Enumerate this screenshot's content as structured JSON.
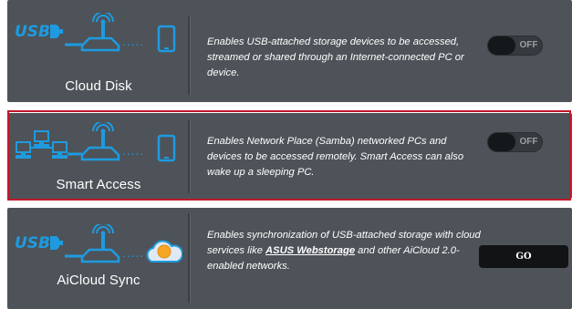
{
  "features": [
    {
      "name": "Cloud Disk",
      "description": "Enables USB-attached storage devices to be accessed, streamed or shared through an Internet-connected PC or device.",
      "toggle": "OFF"
    },
    {
      "name": "Smart Access",
      "description": "Enables Network Place (Samba) networked PCs and devices to be accessed remotely. Smart Access can also wake up a sleeping PC.",
      "toggle": "OFF"
    },
    {
      "name": "AiCloud Sync",
      "description_parts": {
        "before": "Enables synchronization of USB-attached storage with cloud services like ",
        "link": "ASUS Webstorage",
        "after": " and other AiCloud 2.0-enabled networks."
      },
      "button": "GO"
    }
  ],
  "icons": {
    "usb_logo_text": "USB",
    "colors": {
      "icon_blue": "#1e9be0",
      "panel": "#4d5358",
      "highlight": "#c2182b"
    }
  }
}
